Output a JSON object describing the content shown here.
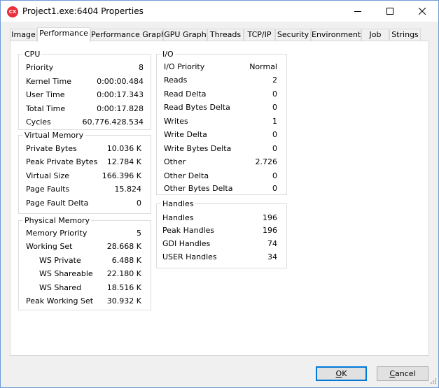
{
  "window": {
    "title": "Project1.exe:6404 Properties",
    "icon_text": "CX"
  },
  "tabs": [
    {
      "label": "Image"
    },
    {
      "label": "Performance"
    },
    {
      "label": "Performance Graph"
    },
    {
      "label": "GPU Graph"
    },
    {
      "label": "Threads"
    },
    {
      "label": "TCP/IP"
    },
    {
      "label": "Security"
    },
    {
      "label": "Environment"
    },
    {
      "label": "Job"
    },
    {
      "label": "Strings"
    }
  ],
  "cpu": {
    "title": "CPU",
    "rows": [
      {
        "label": "Priority",
        "value": "8"
      },
      {
        "label": "Kernel Time",
        "value": "0:00:00.484"
      },
      {
        "label": "User Time",
        "value": "0:00:17.343"
      },
      {
        "label": "Total Time",
        "value": "0:00:17.828"
      },
      {
        "label": "Cycles",
        "value": "60.776.428.534"
      }
    ]
  },
  "virtual_memory": {
    "title": "Virtual Memory",
    "rows": [
      {
        "label": "Private Bytes",
        "value": "10.036 K"
      },
      {
        "label": "Peak Private Bytes",
        "value": "12.784 K"
      },
      {
        "label": "Virtual Size",
        "value": "166.396 K"
      },
      {
        "label": "Page Faults",
        "value": "15.824"
      },
      {
        "label": "Page Fault Delta",
        "value": "0"
      }
    ]
  },
  "physical_memory": {
    "title": "Physical Memory",
    "rows": [
      {
        "label": "Memory Priority",
        "value": "5"
      },
      {
        "label": "Working Set",
        "value": "28.668 K"
      },
      {
        "label": "WS Private",
        "value": "6.488 K"
      },
      {
        "label": "WS Shareable",
        "value": "22.180 K"
      },
      {
        "label": "WS Shared",
        "value": "18.516 K"
      },
      {
        "label": "Peak Working Set",
        "value": "30.932 K"
      }
    ]
  },
  "io": {
    "title": "I/O",
    "rows": [
      {
        "label": "I/O Priority",
        "value": "Normal"
      },
      {
        "label": "Reads",
        "value": "2"
      },
      {
        "label": "Read Delta",
        "value": "0"
      },
      {
        "label": "Read Bytes Delta",
        "value": "0"
      },
      {
        "label": "Writes",
        "value": "1"
      },
      {
        "label": "Write Delta",
        "value": "0"
      },
      {
        "label": "Write Bytes Delta",
        "value": "0"
      },
      {
        "label": "Other",
        "value": "2.726"
      },
      {
        "label": "Other Delta",
        "value": "0"
      },
      {
        "label": "Other Bytes Delta",
        "value": "0"
      }
    ]
  },
  "handles": {
    "title": "Handles",
    "rows": [
      {
        "label": "Handles",
        "value": "196"
      },
      {
        "label": "Peak Handles",
        "value": "196"
      },
      {
        "label": "GDI Handles",
        "value": "74"
      },
      {
        "label": "USER Handles",
        "value": "34"
      }
    ]
  },
  "buttons": {
    "ok_accel": "O",
    "ok_rest": "K",
    "cancel_accel": "C",
    "cancel_rest": "ancel"
  }
}
